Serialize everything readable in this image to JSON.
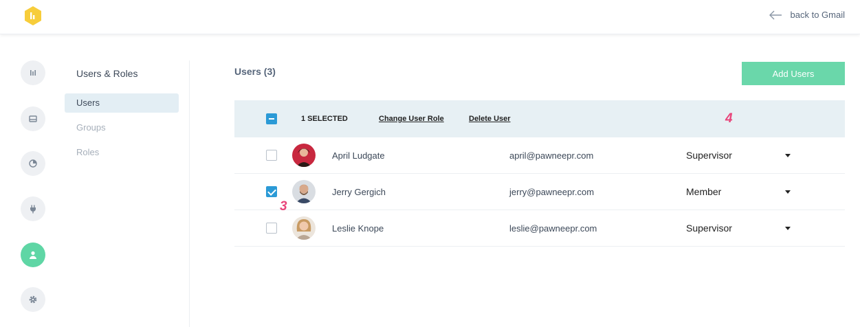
{
  "header": {
    "logo_icon": "app-logo-icon",
    "back_label": "back to Gmail",
    "back_icon": "arrow-left-icon"
  },
  "rail": {
    "items": [
      {
        "icon": "bars-icon"
      },
      {
        "icon": "inbox-icon"
      },
      {
        "icon": "pie-chart-icon"
      },
      {
        "icon": "plug-icon"
      },
      {
        "icon": "user-icon",
        "active": true
      },
      {
        "icon": "gear-icon"
      }
    ],
    "accent": "#5fd6a5"
  },
  "subnav": {
    "title": "Users & Roles",
    "items": [
      {
        "label": "Users",
        "active": true
      },
      {
        "label": "Groups"
      },
      {
        "label": "Roles"
      }
    ]
  },
  "main": {
    "title": "Users (3)",
    "add_button": "Add Users",
    "toolbar": {
      "selected": "1 SELECTED",
      "change_role": "Change User Role",
      "delete_user": "Delete User"
    },
    "users": [
      {
        "name": "April Ludgate",
        "email": "april@pawneepr.com",
        "role": "Supervisor",
        "checked": false
      },
      {
        "name": "Jerry Gergich",
        "email": "jerry@pawneepr.com",
        "role": "Member",
        "checked": true
      },
      {
        "name": "Leslie Knope",
        "email": "leslie@pawneepr.com",
        "role": "Supervisor",
        "checked": false
      }
    ]
  },
  "annotations": {
    "step_3": "3",
    "step_4": "4"
  },
  "colors": {
    "primary_button": "#6ad7aa",
    "checkbox_blue": "#2b9ad6",
    "annotation_pink": "#e8447a",
    "table_header_bg": "#e7f0f4"
  }
}
